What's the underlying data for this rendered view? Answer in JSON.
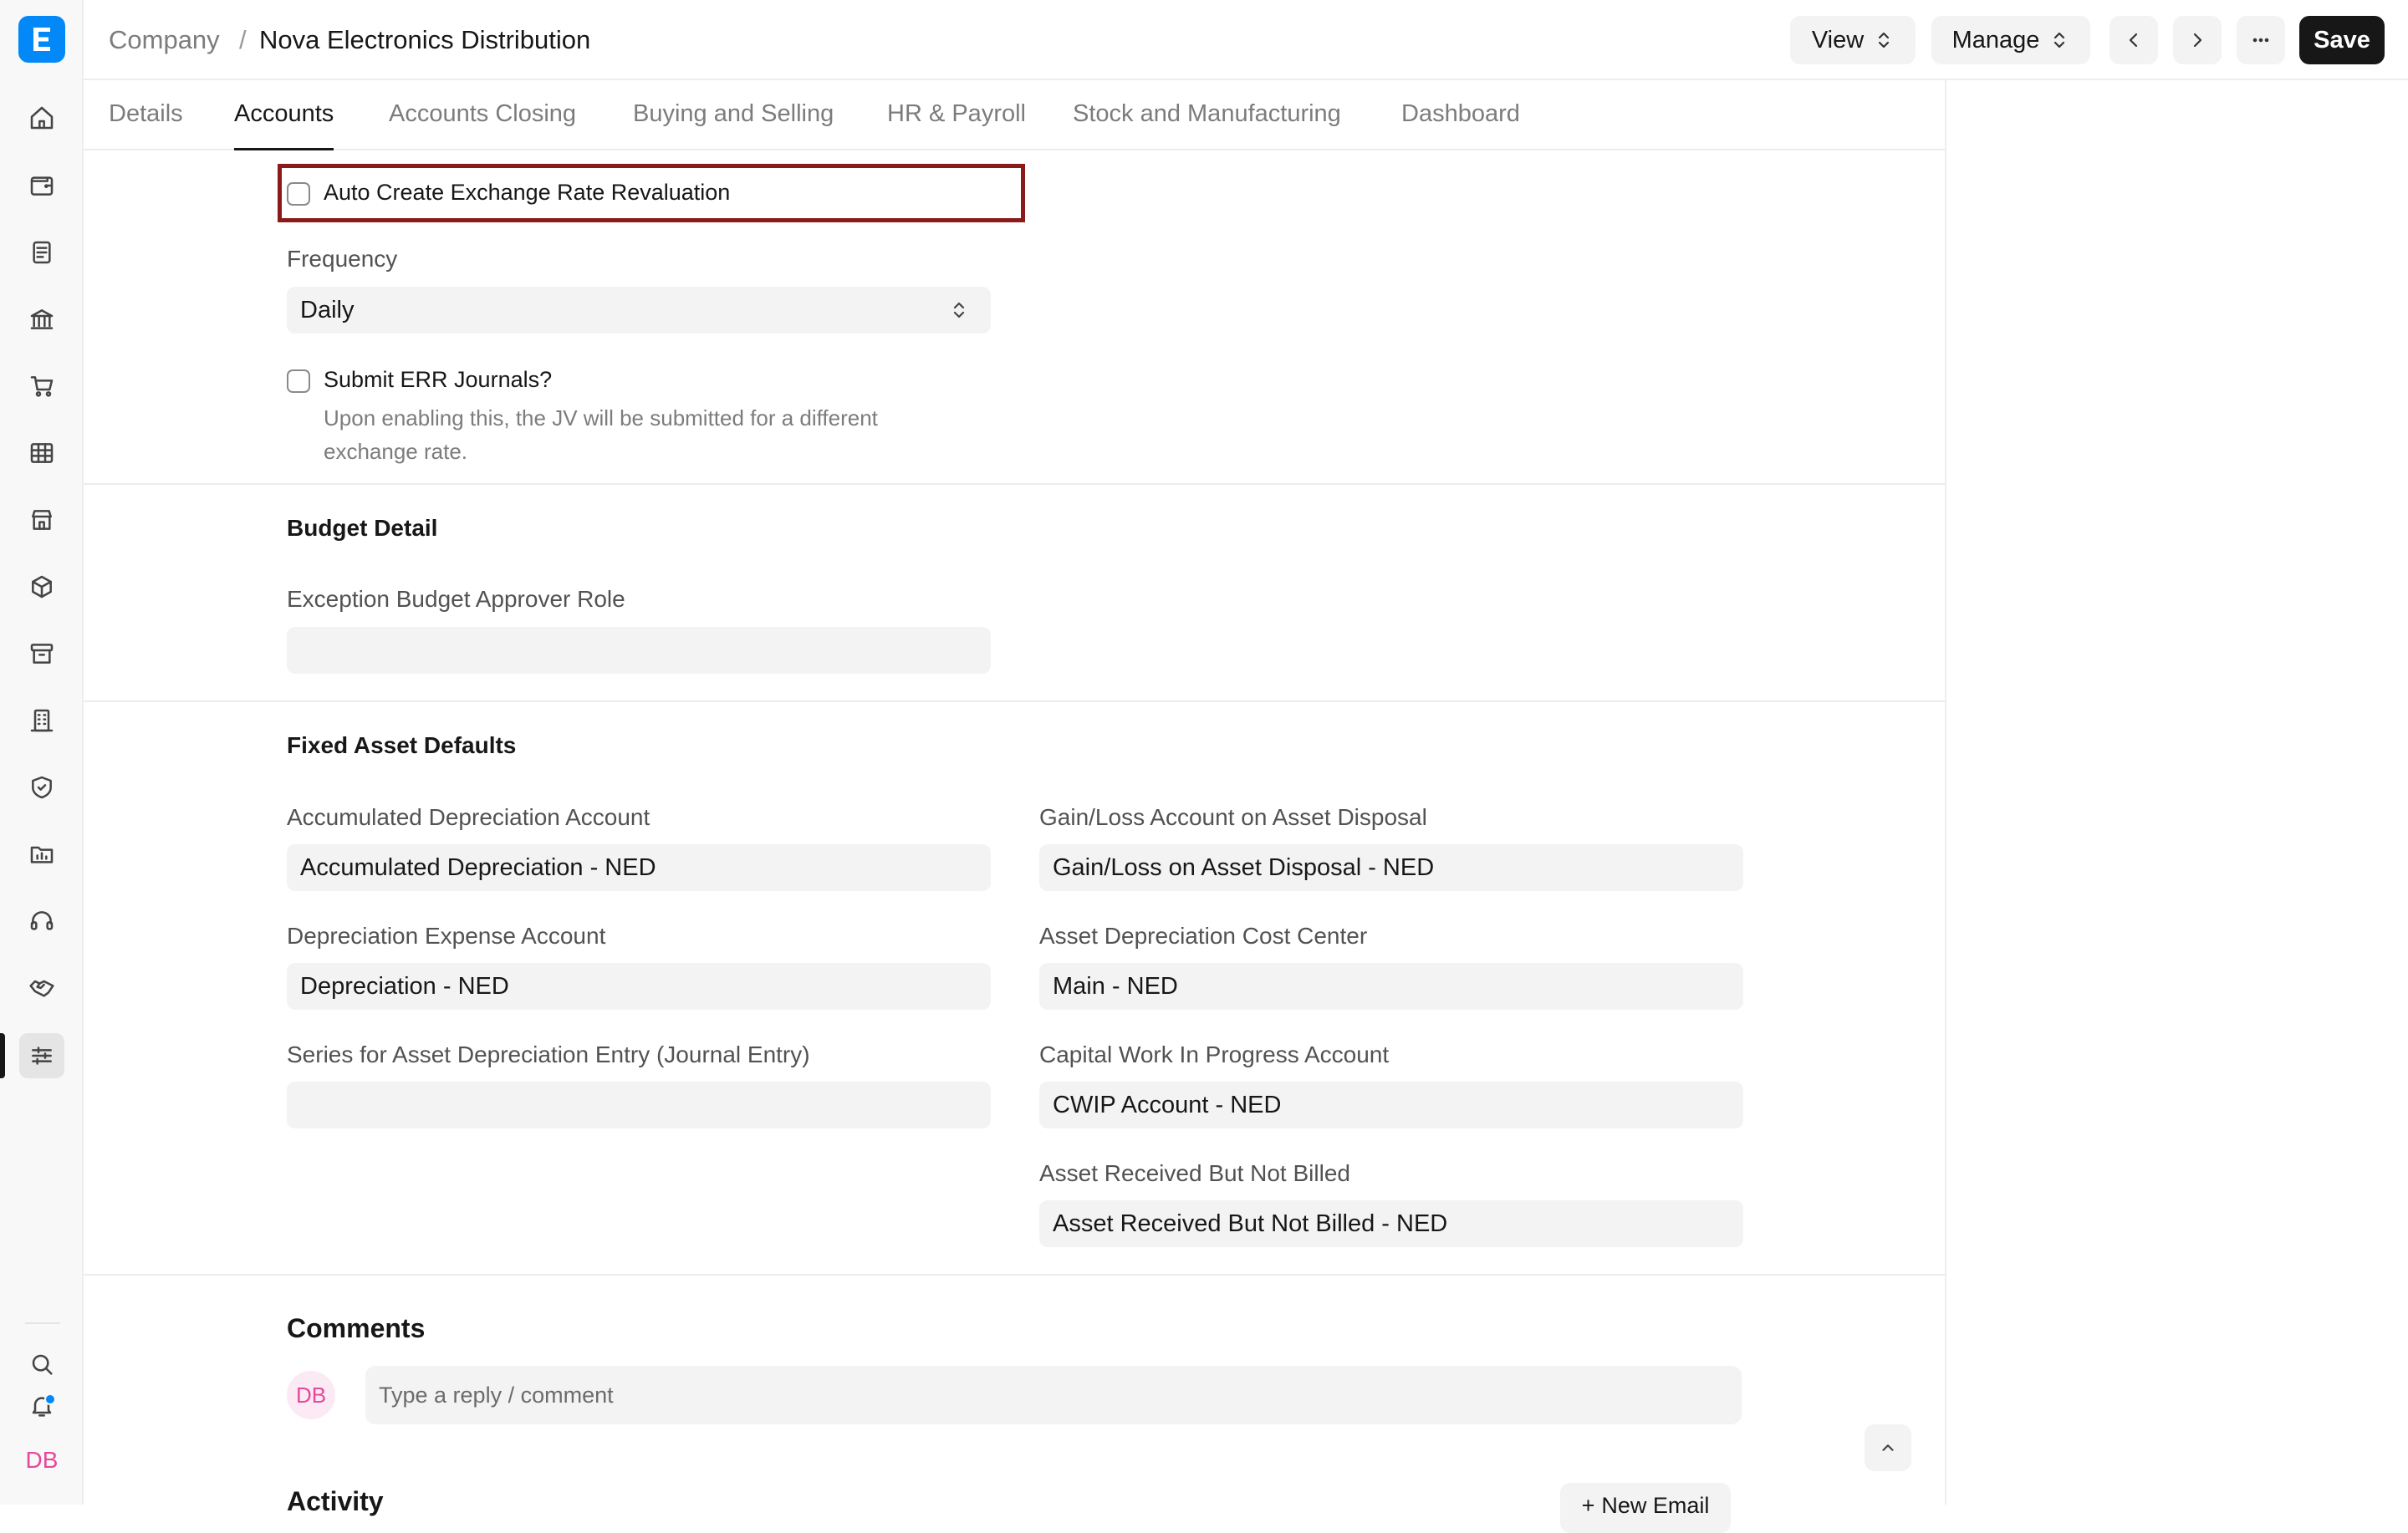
{
  "sidebar": {
    "user_initials": "DB",
    "nav_icons": [
      "home-icon",
      "wallet-icon",
      "file-text-icon",
      "bank-icon",
      "cart-icon",
      "table-icon",
      "store-icon",
      "package-icon",
      "archive-icon",
      "building-icon",
      "shield-icon",
      "folder-chart-icon",
      "headset-icon",
      "handshake-icon",
      "settings-sliders-icon"
    ],
    "active_item": "settings-sliders-icon",
    "notification_dot_color": "#0289f7"
  },
  "header": {
    "breadcrumb_parent": "Company",
    "breadcrumb_separator": "/",
    "title": "Nova Electronics Distribution",
    "view_label": "View",
    "manage_label": "Manage",
    "save_label": "Save"
  },
  "tabs": [
    {
      "label": "Details",
      "active": false
    },
    {
      "label": "Accounts",
      "active": true
    },
    {
      "label": "Accounts Closing",
      "active": false
    },
    {
      "label": "Buying and Selling",
      "active": false
    },
    {
      "label": "HR & Payroll",
      "active": false
    },
    {
      "label": "Stock and Manufacturing",
      "active": false
    },
    {
      "label": "Dashboard",
      "active": false
    }
  ],
  "exchange": {
    "auto_create_label": "Auto Create Exchange Rate Revaluation",
    "auto_create_checked": false,
    "frequency_label": "Frequency",
    "frequency_value": "Daily",
    "submit_err_label": "Submit ERR Journals?",
    "submit_err_checked": false,
    "submit_err_desc": "Upon enabling this, the JV will be submitted for a different exchange rate."
  },
  "budget": {
    "title": "Budget Detail",
    "approver_label": "Exception Budget Approver Role",
    "approver_value": ""
  },
  "fixed_asset": {
    "title": "Fixed Asset Defaults",
    "accumulated_label": "Accumulated Depreciation Account",
    "accumulated_value": "Accumulated Depreciation - NED",
    "expense_label": "Depreciation Expense Account",
    "expense_value": "Depreciation - NED",
    "series_label": "Series for Asset Depreciation Entry (Journal Entry)",
    "series_value": "",
    "gainloss_label": "Gain/Loss Account on Asset Disposal",
    "gainloss_value": "Gain/Loss on Asset Disposal - NED",
    "cost_center_label": "Asset Depreciation Cost Center",
    "cost_center_value": "Main - NED",
    "cwip_label": "Capital Work In Progress Account",
    "cwip_value": "CWIP Account - NED",
    "received_label": "Asset Received But Not Billed",
    "received_value": "Asset Received But Not Billed - NED"
  },
  "comments": {
    "title": "Comments",
    "avatar_initials": "DB",
    "placeholder": "Type a reply / comment"
  },
  "activity": {
    "title": "Activity",
    "new_email_label": "New Email"
  },
  "colors": {
    "accent_blue": "#0289f7",
    "highlight_border": "#8b1a1a",
    "avatar_pink": "#e5489a"
  }
}
